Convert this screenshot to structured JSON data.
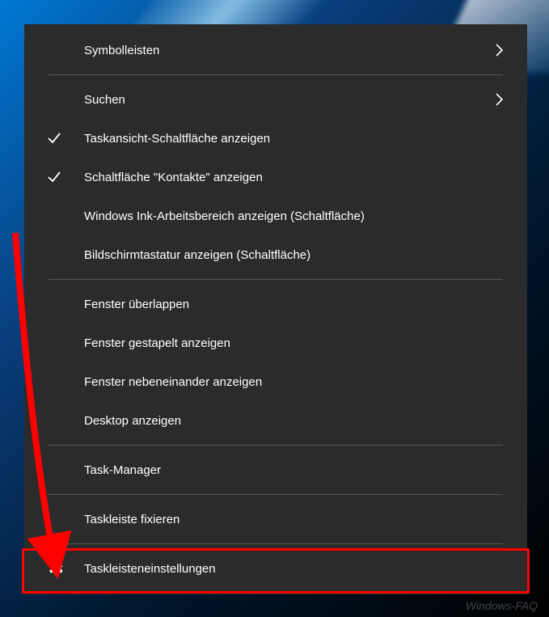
{
  "menu": {
    "items": [
      {
        "label": "Symbolleisten",
        "hasSubmenu": true,
        "checked": false,
        "icon": null
      },
      {
        "label": "Suchen",
        "hasSubmenu": true,
        "checked": false,
        "icon": null
      },
      {
        "label": "Taskansicht-Schaltfläche anzeigen",
        "hasSubmenu": false,
        "checked": true,
        "icon": null
      },
      {
        "label": "Schaltfläche \"Kontakte\" anzeigen",
        "hasSubmenu": false,
        "checked": true,
        "icon": null
      },
      {
        "label": "Windows Ink-Arbeitsbereich anzeigen (Schaltfläche)",
        "hasSubmenu": false,
        "checked": false,
        "icon": null
      },
      {
        "label": "Bildschirmtastatur anzeigen (Schaltfläche)",
        "hasSubmenu": false,
        "checked": false,
        "icon": null
      },
      {
        "label": "Fenster überlappen",
        "hasSubmenu": false,
        "checked": false,
        "icon": null
      },
      {
        "label": "Fenster gestapelt anzeigen",
        "hasSubmenu": false,
        "checked": false,
        "icon": null
      },
      {
        "label": "Fenster nebeneinander anzeigen",
        "hasSubmenu": false,
        "checked": false,
        "icon": null
      },
      {
        "label": "Desktop anzeigen",
        "hasSubmenu": false,
        "checked": false,
        "icon": null
      },
      {
        "label": "Task-Manager",
        "hasSubmenu": false,
        "checked": false,
        "icon": null
      },
      {
        "label": "Taskleiste fixieren",
        "hasSubmenu": false,
        "checked": false,
        "icon": null
      },
      {
        "label": "Taskleisteneinstellungen",
        "hasSubmenu": false,
        "checked": false,
        "icon": "gear"
      }
    ],
    "separatorsAfter": [
      0,
      5,
      9,
      10,
      11
    ]
  },
  "highlightedIndex": 12,
  "watermark": "Windows-FAQ"
}
